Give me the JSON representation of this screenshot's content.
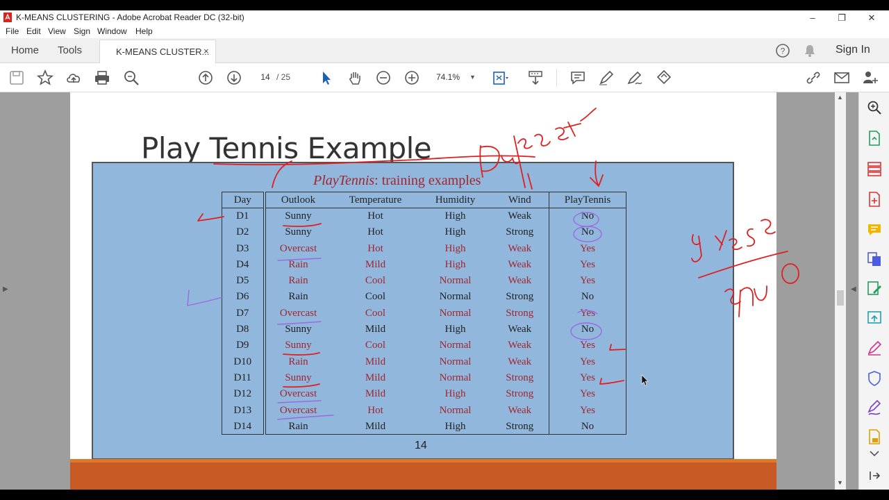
{
  "window": {
    "title": "K-MEANS CLUSTERING - Adobe Acrobat Reader DC (32-bit)",
    "controls": [
      "–",
      "❐",
      "✕"
    ]
  },
  "menu": [
    "File",
    "Edit",
    "View",
    "Sign",
    "Window",
    "Help"
  ],
  "tabs": {
    "home": "Home",
    "tools": "Tools",
    "document": "K-MEANS CLUSTER...",
    "close": "×",
    "sign_in": "Sign In"
  },
  "toolbar": {
    "page_current": "14",
    "page_total": "/ 25",
    "zoom": "74.1%"
  },
  "slide": {
    "title": "Play Tennis Example",
    "caption_italic": "PlayTennis",
    "caption_rest": ": training examples",
    "page_number": "14",
    "headers": [
      "Day",
      "Outlook",
      "Temperature",
      "Humidity",
      "Wind",
      "PlayTennis"
    ],
    "rows": [
      [
        "D1",
        "Sunny",
        "Hot",
        "High",
        "Weak",
        "No"
      ],
      [
        "D2",
        "Sunny",
        "Hot",
        "High",
        "Strong",
        "No"
      ],
      [
        "D3",
        "Overcast",
        "Hot",
        "High",
        "Weak",
        "Yes"
      ],
      [
        "D4",
        "Rain",
        "Mild",
        "High",
        "Weak",
        "Yes"
      ],
      [
        "D5",
        "Rain",
        "Cool",
        "Normal",
        "Weak",
        "Yes"
      ],
      [
        "D6",
        "Rain",
        "Cool",
        "Normal",
        "Strong",
        "No"
      ],
      [
        "D7",
        "Overcast",
        "Cool",
        "Normal",
        "Strong",
        "Yes"
      ],
      [
        "D8",
        "Sunny",
        "Mild",
        "High",
        "Weak",
        "No"
      ],
      [
        "D9",
        "Sunny",
        "Cool",
        "Normal",
        "Weak",
        "Yes"
      ],
      [
        "D10",
        "Rain",
        "Mild",
        "Normal",
        "Weak",
        "Yes"
      ],
      [
        "D11",
        "Sunny",
        "Mild",
        "Normal",
        "Strong",
        "Yes"
      ],
      [
        "D12",
        "Overcast",
        "Mild",
        "High",
        "Strong",
        "Yes"
      ],
      [
        "D13",
        "Overcast",
        "Hot",
        "Normal",
        "Weak",
        "Yes"
      ],
      [
        "D14",
        "Rain",
        "Mild",
        "High",
        "Strong",
        "No"
      ]
    ],
    "red_rows": [
      2,
      3,
      4,
      6,
      8,
      9,
      10,
      11,
      12
    ]
  },
  "handwriting": {
    "dataset": "Dataset",
    "yes_count": "9 Yes",
    "no_count": "5 No"
  },
  "colors": {
    "panel": "#92b7dd",
    "red_text": "#a0262e",
    "ink_red": "#e02020",
    "ink_purple": "#9a6ae0",
    "orange_bar": "#c85a26"
  },
  "icons": {
    "toolbar": [
      "save-icon",
      "bookmark-star-icon",
      "upload-cloud-icon",
      "print-icon",
      "search-zoom-icon",
      "page-up-icon",
      "page-down-icon",
      "select-arrow-icon",
      "hand-tool-icon",
      "zoom-out-icon",
      "zoom-in-icon",
      "fit-page-icon",
      "scroll-mode-icon",
      "comment-icon",
      "highlight-pen-icon",
      "sign-pen-icon",
      "stamp-icon",
      "share-link-icon",
      "email-icon",
      "add-user-icon"
    ],
    "right_panel": [
      "search-icon",
      "export-pdf-icon",
      "organize-pages-icon",
      "create-pdf-icon",
      "comment-icon",
      "combine-icon",
      "edit-pdf-icon",
      "export-icon",
      "fill-sign-icon",
      "protect-icon",
      "sign-icon",
      "more-tools-icon",
      "collapse-icon"
    ]
  }
}
